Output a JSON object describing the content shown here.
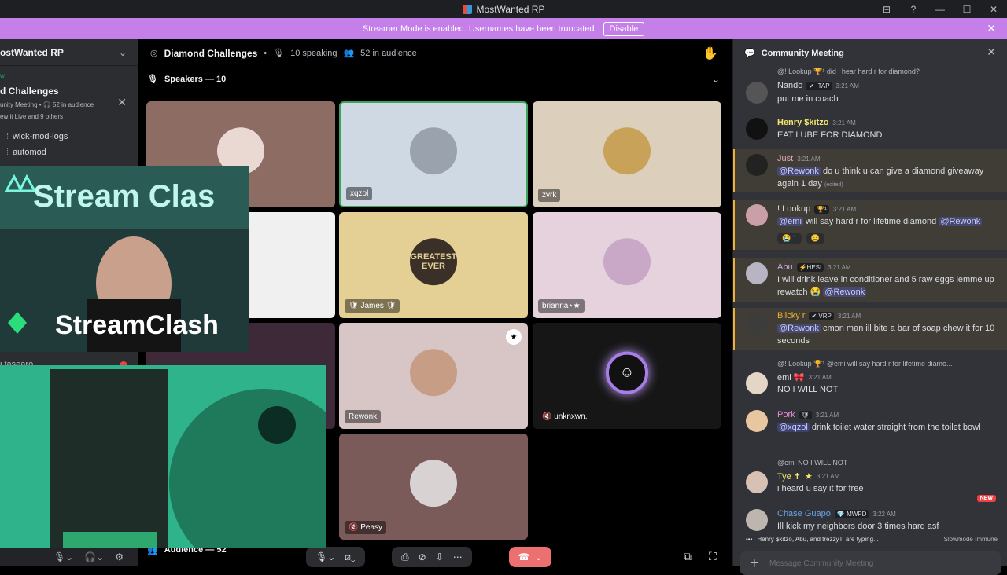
{
  "app": {
    "title": "MostWanted RP"
  },
  "window_controls": [
    "⊟",
    "?",
    "—",
    "☐",
    "✕"
  ],
  "banner": {
    "text": "Streamer Mode is enabled. Usernames have been truncated.",
    "button": "Disable"
  },
  "sidebar": {
    "server_name": "ostWanted RP",
    "stage_card": {
      "live": "w",
      "title": "d Challenges",
      "meta": "unity Meeting • 🎧 52 in audience",
      "viewers": "ew it Live and 9 others"
    },
    "channels": [
      {
        "label": "wick-mod-logs"
      },
      {
        "label": "automod"
      }
    ],
    "partial_item": "i tasearo"
  },
  "stage": {
    "title": "Diamond Challenges",
    "speaking": "10 speaking",
    "audience": "52 in audience",
    "speakers_header": "Speakers — 10",
    "audience_footer": "Audience — 52",
    "tiles": [
      {
        "name": "",
        "bg": "#8c6c63"
      },
      {
        "name": "xqzol",
        "bg": "#cfd9e4"
      },
      {
        "name": "zvrk",
        "bg": "#dcd0bd"
      },
      {
        "name": "",
        "bg": "#f0f0f0"
      },
      {
        "name": "🛡 James 🛡",
        "bg": "#e4cf94",
        "avatar_text": "GREATEST EVER"
      },
      {
        "name": "brianna⋆★",
        "bg": "#e6d2dc"
      },
      {
        "name": "",
        "bg": "#3d2938"
      },
      {
        "name": "Rewonk",
        "bg": "#d8c5c5"
      },
      {
        "name": "🔇 unknxwn.",
        "bg": "#161616"
      },
      {
        "name": "🔇 Peasy",
        "bg": "#7b5a5a"
      }
    ]
  },
  "overlay": {
    "brand": "StreamClash",
    "brand_top": "Stream Clas"
  },
  "chat": {
    "title": "Community Meeting",
    "messages": [
      {
        "reply": "@! Lookup 🏆¹ did i hear hard r for diamond?",
        "author": "Nando",
        "tag": "✔ ITAP",
        "time": "3:21 AM",
        "text": "put me in coach",
        "color": "#dbdee1"
      },
      {
        "author": "Henry $kitzo",
        "time": "3:21 AM",
        "text": "EAT LUBE FOR DIAMOND",
        "color": "#f2e66b"
      },
      {
        "author": "Just",
        "time": "3:21 AM",
        "mention": "@Rewonk",
        "text": " do u think u can give a diamond giveaway again 1 day",
        "edited": "(edited)",
        "color": "#e3a6b8"
      },
      {
        "author": "! Lookup",
        "tag": "🏆¹",
        "time": "3:21 AM",
        "mention": "@emi",
        "text": " will say hard r for lifetime diamond ",
        "mention2": "@Rewonk",
        "reactions": [
          "😭 1",
          "😑"
        ],
        "color": "#dbdee1"
      },
      {
        "author": "Abu",
        "tag": "⚡HESI",
        "time": "3:21 AM",
        "text": "I will drink leave in conditioner and 5 raw eggs lemme up rewatch 😭 ",
        "mention": "@Rewonk",
        "color": "#c7a5e6"
      },
      {
        "author": "Blicky r",
        "tag": "✔ VRP",
        "time": "3:21 AM",
        "mention": "@Rewonk",
        "text": " cmon man ill bite a bar of soap chew it for 10 seconds",
        "color": "#f0b132"
      },
      {
        "reply": "@! Lookup 🏆¹ @emi will say hard r for lifetime diamo...",
        "author": "emi 🎀",
        "time": "3:21 AM",
        "text": "NO I WILL NOT",
        "color": "#dbdee1"
      },
      {
        "author": "Pork",
        "tag": "🛡",
        "time": "3:21 AM",
        "mention": "@xqzol",
        "text": " drink toilet water straight from the toilet bowl",
        "color": "#e78fd2"
      },
      {
        "reply": "@emi NO I WILL NOT",
        "author": "Tye ✝",
        "tag": "★",
        "time": "3:21 AM",
        "text": "i heard u say it for free",
        "color": "#f2e66b"
      },
      {
        "author": "Chase Guapo",
        "tag": "💎 MWPD",
        "time": "3:22 AM",
        "text": "Ill kick my neighbors door 3 times hard asf",
        "color": "#69a4e8"
      }
    ],
    "new_label": "NEW",
    "typing": "Henry $kitzo, Abu, and trezzyT. are typing...",
    "slowmode": "Slowmode Immune",
    "input_placeholder": "Message Community Meeting"
  },
  "colors": {
    "accent": "#5865f2",
    "banner": "#c47fe8",
    "danger": "#ec7070",
    "highlight": "#f0b132"
  }
}
